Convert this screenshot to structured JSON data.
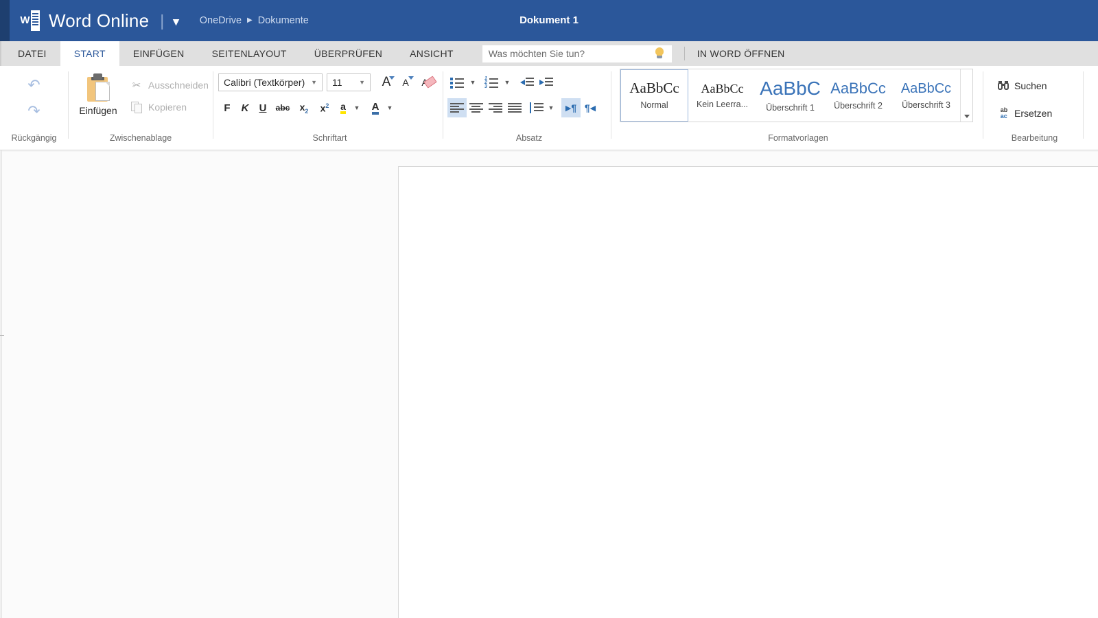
{
  "titlebar": {
    "app_name": "Word Online",
    "logo_letter": "W",
    "separator": "|",
    "chevron": "⌄",
    "breadcrumb": {
      "root": "OneDrive",
      "arrow": "▶",
      "folder": "Dokumente"
    },
    "document_title": "Dokument 1",
    "bg_color": "#2b579a",
    "text_color": "#ffffff"
  },
  "tabs": [
    {
      "label": "DATEI",
      "active": false
    },
    {
      "label": "START",
      "active": true
    },
    {
      "label": "EINFÜGEN",
      "active": false
    },
    {
      "label": "SEITENLAYOUT",
      "active": false
    },
    {
      "label": "ÜBERPRÜFEN",
      "active": false
    },
    {
      "label": "ANSICHT",
      "active": false
    }
  ],
  "tellme": {
    "placeholder": "Was möchten Sie tun?",
    "value": "",
    "icon": "lightbulb-icon"
  },
  "open_in_word": "IN WORD ÖFFNEN",
  "ribbon": {
    "groups": [
      {
        "label": "Rückgängig"
      },
      {
        "label": "Zwischenablage"
      },
      {
        "label": "Schriftart"
      },
      {
        "label": "Absatz"
      },
      {
        "label": "Formatvorlagen"
      },
      {
        "label": "Bearbeitung"
      }
    ],
    "undo_group": {
      "undo_icon": "undo-arrow-icon",
      "undo_glyph": "↶",
      "redo_icon": "redo-arrow-icon",
      "redo_glyph": "↷"
    },
    "clipboard_group": {
      "paste_label": "Einfügen",
      "cut_label": "Ausschneiden",
      "cut_glyph": "✂",
      "copy_label": "Kopieren"
    },
    "font_group": {
      "font_name": "Calibri (Textkörper)",
      "font_size": "11",
      "grow_font": "A",
      "shrink_font": "A",
      "clear_formatting": "A",
      "bold": "F",
      "italic": "K",
      "underline": "U",
      "strikethrough": "abc",
      "subscript_base": "x",
      "subscript_sub": "2",
      "superscript_base": "x",
      "superscript_sup": "2",
      "highlight": "a",
      "font_color": "A",
      "highlight_color": "#ffe500",
      "font_color_swatch": "#3b6fa8"
    },
    "paragraph_group": {
      "bullets": "bullets-icon",
      "numbering": "numbering-icon",
      "decrease_indent": "decrease-indent-icon",
      "increase_indent": "increase-indent-icon",
      "align_left": "align-left-icon",
      "align_center": "align-center-icon",
      "align_right": "align-right-icon",
      "align_justify": "align-justify-icon",
      "line_spacing": "line-spacing-icon",
      "ltr": "¶",
      "rtl": "¶",
      "selected_alignment": "align_left",
      "numbering_digits": [
        "1",
        "2",
        "3"
      ]
    },
    "styles": [
      {
        "preview": "AaBbCc",
        "name": "Normal",
        "active": true,
        "size": 21,
        "color": "#1f1f1f"
      },
      {
        "preview": "AaBbCc",
        "name": "Kein Leerra...",
        "active": false,
        "size": 18,
        "color": "#1f1f1f"
      },
      {
        "preview": "AaBbC",
        "name": "Überschrift 1",
        "active": false,
        "size": 27,
        "color": "#3a73b8"
      },
      {
        "preview": "AaBbCc",
        "name": "Überschrift 2",
        "active": false,
        "size": 22,
        "color": "#3a73b8"
      },
      {
        "preview": "AaBbCc",
        "name": "Überschrift 3",
        "active": false,
        "size": 20,
        "color": "#3a73b8"
      }
    ],
    "styles_scroll": "scroll-down-icon",
    "editing_group": {
      "find_label": "Suchen",
      "find_icon": "binoculars-icon",
      "find_glyph": "♍",
      "replace_label": "Ersetzen",
      "replace_icon": "replace-icon",
      "replace_top": "ab",
      "replace_bottom": "ac"
    }
  },
  "document": {
    "page_background": "#ffffff",
    "canvas_background": "#fbfbfb",
    "body_text": ""
  }
}
